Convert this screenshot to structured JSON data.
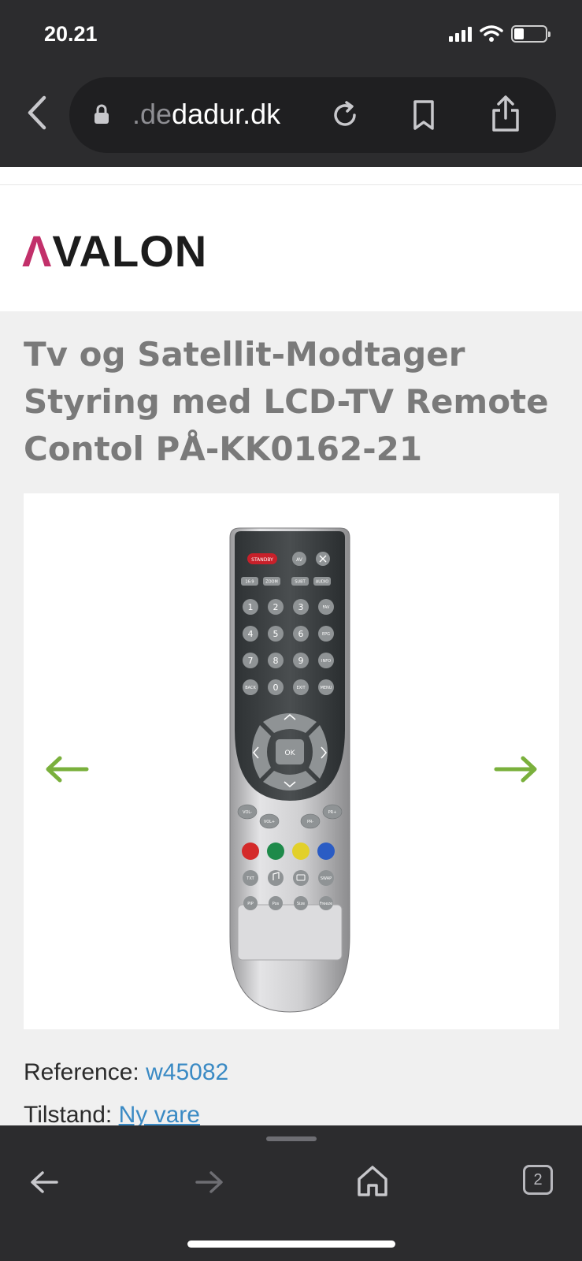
{
  "status": {
    "time": "20.21"
  },
  "browser": {
    "url_prefix": ".de",
    "url_main": "dadur.dk",
    "icons": [
      "chevron-left-icon",
      "lock-icon",
      "reload-icon",
      "bookmark-icon",
      "share-icon"
    ]
  },
  "site": {
    "logo_mark": "Λ",
    "logo_text": "VALON"
  },
  "product": {
    "title": "Tv og Satellit-Modtager Styring med LCD-TV Remote Contol PÅ-KK0162-21",
    "reference_label": "Reference:",
    "reference_value": "w45082",
    "condition_label": "Tilstand:",
    "condition_value": "Ny vare",
    "remote_labels": {
      "standby": "STANDBY",
      "av": "AV",
      "r169": "16:9",
      "zoom": "ZOOM",
      "subt": "SUBT",
      "audio": "AUDIO",
      "n1": "1",
      "n2": "2",
      "n3": "3",
      "fav": "FAV",
      "n4": "4",
      "n5": "5",
      "n6": "6",
      "epg": "EPG",
      "n7": "7",
      "n8": "8",
      "n9": "9",
      "info": "INFO",
      "back": "BACK",
      "n0": "0",
      "exit": "EXIT",
      "menu": "MENU",
      "ok": "OK",
      "volm": "VOL-",
      "volp": "VOL+",
      "prm": "PR-",
      "prp": "PR+",
      "txt": "TXT",
      "swap": "SWAP",
      "pip": "PIP",
      "pos": "Pos",
      "size": "Size",
      "freeze": "Freeze"
    }
  },
  "colors": {
    "accent_green": "#7ab03c",
    "link_blue": "#3a8ac4",
    "logo_pink": "#c2306a"
  },
  "toolbar": {
    "tab_count": "2"
  }
}
